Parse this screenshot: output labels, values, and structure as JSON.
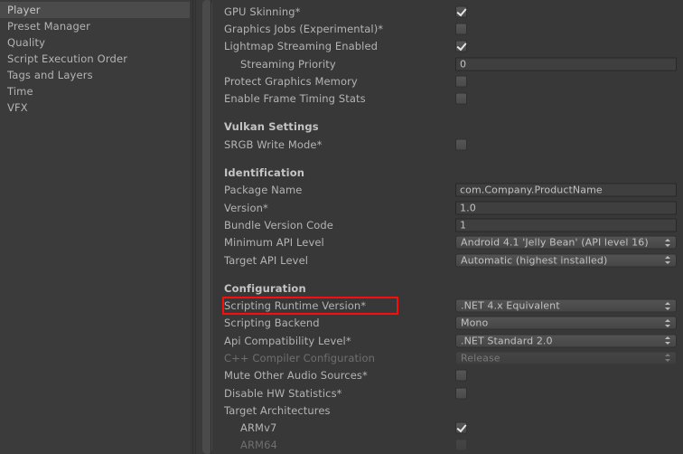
{
  "colors": {
    "background": "#383838",
    "sidebar_bg": "#3b3b3b",
    "selection": "#4b4b4b",
    "label": "#b4b4b4",
    "label_disabled": "#6f6f6f",
    "section_header": "#c4c4c4",
    "highlight_outline": "#fc0d0d"
  },
  "sidebar": {
    "items": [
      {
        "label": "Player",
        "selected": true
      },
      {
        "label": "Preset Manager",
        "selected": false
      },
      {
        "label": "Quality",
        "selected": false
      },
      {
        "label": "Script Execution Order",
        "selected": false
      },
      {
        "label": "Tags and Layers",
        "selected": false
      },
      {
        "label": "Time",
        "selected": false
      },
      {
        "label": "VFX",
        "selected": false
      }
    ]
  },
  "settings": {
    "rows": [
      {
        "kind": "row",
        "label": "GPU Skinning*",
        "control": "checkbox",
        "checked": true,
        "indent": 0,
        "disabled": false
      },
      {
        "kind": "row",
        "label": "Graphics Jobs (Experimental)*",
        "control": "checkbox",
        "checked": false,
        "indent": 0,
        "disabled": false
      },
      {
        "kind": "row",
        "label": "Lightmap Streaming Enabled",
        "control": "checkbox",
        "checked": true,
        "indent": 0,
        "disabled": false
      },
      {
        "kind": "row",
        "label": "Streaming Priority",
        "control": "textfield",
        "value": "0",
        "indent": 1,
        "disabled": false
      },
      {
        "kind": "row",
        "label": "Protect Graphics Memory",
        "control": "checkbox",
        "checked": false,
        "indent": 0,
        "disabled": false
      },
      {
        "kind": "row",
        "label": "Enable Frame Timing Stats",
        "control": "checkbox",
        "checked": false,
        "indent": 0,
        "disabled": false
      },
      {
        "kind": "section",
        "label": "Vulkan Settings"
      },
      {
        "kind": "row",
        "label": "SRGB Write Mode*",
        "control": "checkbox",
        "checked": false,
        "indent": 0,
        "disabled": false
      },
      {
        "kind": "section",
        "label": "Identification"
      },
      {
        "kind": "row",
        "label": "Package Name",
        "control": "textfield",
        "value": "com.Company.ProductName",
        "indent": 0,
        "disabled": false
      },
      {
        "kind": "row",
        "label": "Version*",
        "control": "textfield",
        "value": "1.0",
        "indent": 0,
        "disabled": false
      },
      {
        "kind": "row",
        "label": "Bundle Version Code",
        "control": "textfield",
        "value": "1",
        "indent": 0,
        "disabled": false
      },
      {
        "kind": "row",
        "label": "Minimum API Level",
        "control": "dropdown",
        "value": "Android 4.1 'Jelly Bean' (API level 16)",
        "indent": 0,
        "disabled": false
      },
      {
        "kind": "row",
        "label": "Target API Level",
        "control": "dropdown",
        "value": "Automatic (highest installed)",
        "indent": 0,
        "disabled": false
      },
      {
        "kind": "section",
        "label": "Configuration"
      },
      {
        "kind": "row",
        "label": "Scripting Runtime Version*",
        "control": "dropdown",
        "value": ".NET 4.x Equivalent",
        "indent": 0,
        "disabled": false,
        "highlighted": true
      },
      {
        "kind": "row",
        "label": "Scripting Backend",
        "control": "dropdown",
        "value": "Mono",
        "indent": 0,
        "disabled": false
      },
      {
        "kind": "row",
        "label": "Api Compatibility Level*",
        "control": "dropdown",
        "value": ".NET Standard 2.0",
        "indent": 0,
        "disabled": false
      },
      {
        "kind": "row",
        "label": "C++ Compiler Configuration",
        "control": "dropdown",
        "value": "Release",
        "indent": 0,
        "disabled": true
      },
      {
        "kind": "row",
        "label": "Mute Other Audio Sources*",
        "control": "checkbox",
        "checked": false,
        "indent": 0,
        "disabled": false
      },
      {
        "kind": "row",
        "label": "Disable HW Statistics*",
        "control": "checkbox",
        "checked": false,
        "indent": 0,
        "disabled": false
      },
      {
        "kind": "row",
        "label": "Target Architectures",
        "control": "none",
        "indent": 0,
        "disabled": false
      },
      {
        "kind": "row",
        "label": "ARMv7",
        "control": "checkbox",
        "checked": true,
        "indent": 1,
        "disabled": false
      },
      {
        "kind": "row",
        "label": "ARM64",
        "control": "checkbox",
        "checked": false,
        "indent": 1,
        "disabled": true
      }
    ]
  }
}
